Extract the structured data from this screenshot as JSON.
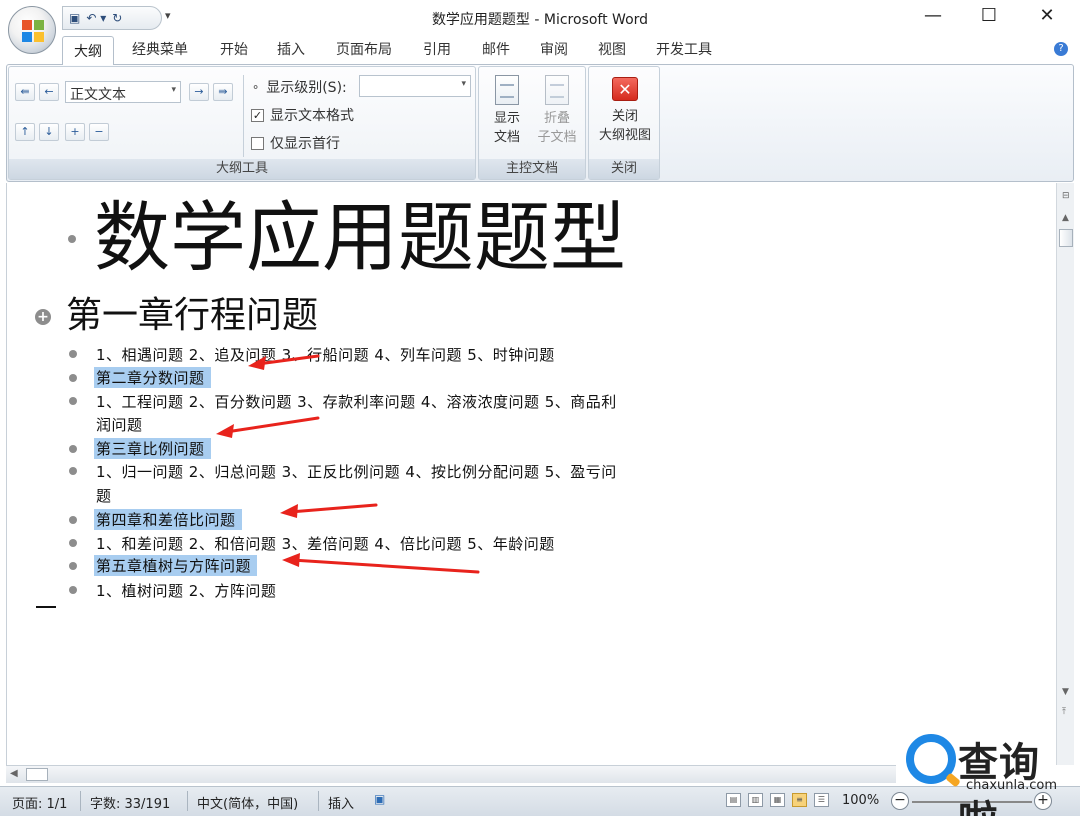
{
  "window": {
    "title": "数学应用题题型 - Microsoft Word",
    "qat_more": "▾",
    "minimize": "—",
    "maximize": "☐",
    "close": "✕"
  },
  "tabs": [
    "大纲",
    "经典菜单",
    "开始",
    "插入",
    "页面布局",
    "引用",
    "邮件",
    "审阅",
    "视图",
    "开发工具"
  ],
  "ribbon": {
    "outline_tools": {
      "label": "大纲工具",
      "level_combo": "正文文本",
      "show_level_label": "显示级别(S):",
      "show_level_value": "",
      "show_text_format": "显示文本格式",
      "show_text_format_checked": true,
      "show_first_line": "仅显示首行",
      "show_first_line_checked": false
    },
    "master_doc": {
      "label": "主控文档",
      "show_doc": [
        "显示",
        "文档"
      ],
      "collapse_sub": [
        "折叠",
        "子文档"
      ]
    },
    "close": {
      "label": "关闭",
      "close_outline": [
        "关闭",
        "大纲视图"
      ]
    }
  },
  "document": {
    "title": "数学应用题题型",
    "chapter1": "第一章行程问题",
    "lines": [
      {
        "text": "1、相遇问题 2、追及问题 3、行船问题 4、列车问题 5、时钟问题",
        "highlight": false
      },
      {
        "text": "第二章分数问题",
        "highlight": true
      },
      {
        "text": "1、工程问题 2、百分数问题 3、存款利率问题 4、溶液浓度问题 5、商品利",
        "cont": "润问题",
        "highlight": false
      },
      {
        "text": "第三章比例问题",
        "highlight": true
      },
      {
        "text": "1、归一问题 2、归总问题 3、正反比例问题 4、按比例分配问题 5、盈亏问",
        "cont": "题",
        "highlight": false
      },
      {
        "text": "第四章和差倍比问题",
        "highlight": true
      },
      {
        "text": "1、和差问题 2、和倍问题 3、差倍问题 4、倍比问题 5、年龄问题",
        "highlight": false
      },
      {
        "text": "第五章植树与方阵问题",
        "highlight": true
      },
      {
        "text": "1、植树问题 2、方阵问题",
        "highlight": false
      }
    ]
  },
  "status": {
    "page": "页面: 1/1",
    "words": "字数: 33/191",
    "language": "中文(简体，中国)",
    "mode": "插入",
    "zoom": "100%"
  },
  "watermark": {
    "brand": "查询啦",
    "url": "chaxunla.com"
  },
  "colors": {
    "highlight": "#a8cdf0",
    "arrow": "#e8231c",
    "ribbon": "#e9eef4"
  }
}
